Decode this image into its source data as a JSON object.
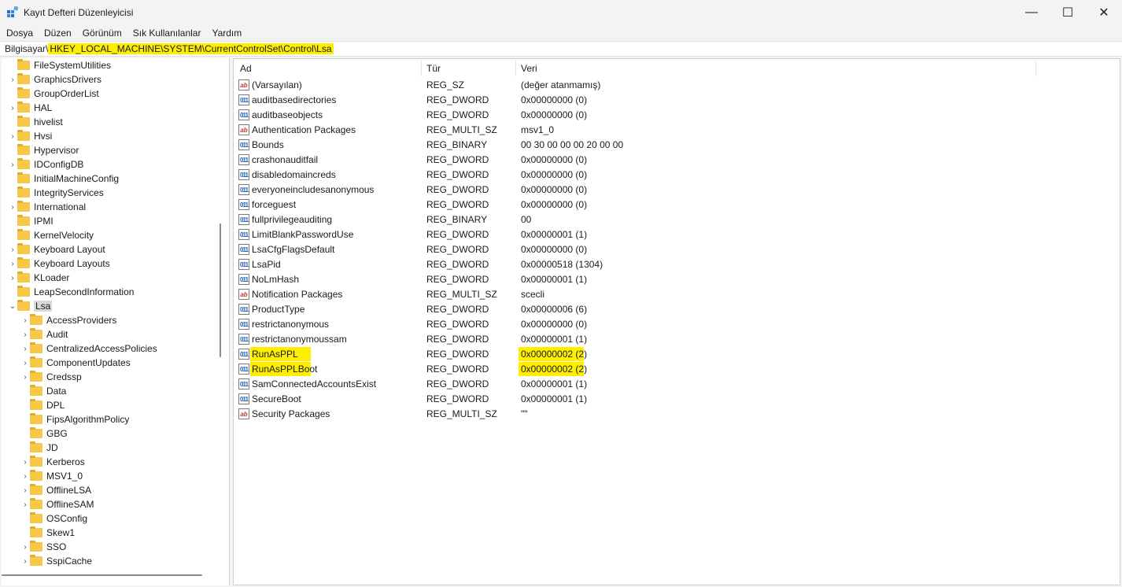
{
  "window": {
    "title": "Kayıt Defteri Düzenleyicisi",
    "min": "—",
    "max": "☐",
    "close": "✕"
  },
  "menu": [
    "Dosya",
    "Düzen",
    "Görünüm",
    "Sık Kullanılanlar",
    "Yardım"
  ],
  "address": {
    "root": "Bilgisayar",
    "sep": "\\",
    "path": "HKEY_LOCAL_MACHINE\\SYSTEM\\CurrentControlSet\\Control\\Lsa"
  },
  "tree": [
    {
      "label": "FileSystemUtilities",
      "expandable": false,
      "depth": 0
    },
    {
      "label": "GraphicsDrivers",
      "expandable": true,
      "depth": 0
    },
    {
      "label": "GroupOrderList",
      "expandable": false,
      "depth": 0
    },
    {
      "label": "HAL",
      "expandable": true,
      "depth": 0
    },
    {
      "label": "hivelist",
      "expandable": false,
      "depth": 0
    },
    {
      "label": "Hvsi",
      "expandable": true,
      "depth": 0
    },
    {
      "label": "Hypervisor",
      "expandable": false,
      "depth": 0
    },
    {
      "label": "IDConfigDB",
      "expandable": true,
      "depth": 0
    },
    {
      "label": "InitialMachineConfig",
      "expandable": false,
      "depth": 0
    },
    {
      "label": "IntegrityServices",
      "expandable": false,
      "depth": 0
    },
    {
      "label": "International",
      "expandable": true,
      "depth": 0
    },
    {
      "label": "IPMI",
      "expandable": false,
      "depth": 0
    },
    {
      "label": "KernelVelocity",
      "expandable": false,
      "depth": 0
    },
    {
      "label": "Keyboard Layout",
      "expandable": true,
      "depth": 0
    },
    {
      "label": "Keyboard Layouts",
      "expandable": true,
      "depth": 0
    },
    {
      "label": "KLoader",
      "expandable": true,
      "depth": 0
    },
    {
      "label": "LeapSecondInformation",
      "expandable": false,
      "depth": 0
    },
    {
      "label": "Lsa",
      "expandable": true,
      "expanded": true,
      "selected": true,
      "depth": 0
    },
    {
      "label": "AccessProviders",
      "expandable": true,
      "depth": 1
    },
    {
      "label": "Audit",
      "expandable": true,
      "depth": 1
    },
    {
      "label": "CentralizedAccessPolicies",
      "expandable": true,
      "depth": 1
    },
    {
      "label": "ComponentUpdates",
      "expandable": true,
      "depth": 1
    },
    {
      "label": "Credssp",
      "expandable": true,
      "depth": 1
    },
    {
      "label": "Data",
      "expandable": false,
      "depth": 1
    },
    {
      "label": "DPL",
      "expandable": false,
      "depth": 1
    },
    {
      "label": "FipsAlgorithmPolicy",
      "expandable": false,
      "depth": 1
    },
    {
      "label": "GBG",
      "expandable": false,
      "depth": 1
    },
    {
      "label": "JD",
      "expandable": false,
      "depth": 1
    },
    {
      "label": "Kerberos",
      "expandable": true,
      "depth": 1
    },
    {
      "label": "MSV1_0",
      "expandable": true,
      "depth": 1
    },
    {
      "label": "OfflineLSA",
      "expandable": true,
      "depth": 1
    },
    {
      "label": "OfflineSAM",
      "expandable": true,
      "depth": 1
    },
    {
      "label": "OSConfig",
      "expandable": false,
      "depth": 1
    },
    {
      "label": "Skew1",
      "expandable": false,
      "depth": 1
    },
    {
      "label": "SSO",
      "expandable": true,
      "depth": 1
    },
    {
      "label": "SspiCache",
      "expandable": true,
      "depth": 1
    }
  ],
  "columns": {
    "name": "Ad",
    "type": "Tür",
    "data": "Veri"
  },
  "values": [
    {
      "name": "(Varsayılan)",
      "type": "REG_SZ",
      "data": "(değer atanmamış)",
      "icon": "string"
    },
    {
      "name": "auditbasedirectories",
      "type": "REG_DWORD",
      "data": "0x00000000 (0)",
      "icon": "binary"
    },
    {
      "name": "auditbaseobjects",
      "type": "REG_DWORD",
      "data": "0x00000000 (0)",
      "icon": "binary"
    },
    {
      "name": "Authentication Packages",
      "type": "REG_MULTI_SZ",
      "data": "msv1_0",
      "icon": "string"
    },
    {
      "name": "Bounds",
      "type": "REG_BINARY",
      "data": "00 30 00 00 00 20 00 00",
      "icon": "binary"
    },
    {
      "name": "crashonauditfail",
      "type": "REG_DWORD",
      "data": "0x00000000 (0)",
      "icon": "binary"
    },
    {
      "name": "disabledomaincreds",
      "type": "REG_DWORD",
      "data": "0x00000000 (0)",
      "icon": "binary"
    },
    {
      "name": "everyoneincludesanonymous",
      "type": "REG_DWORD",
      "data": "0x00000000 (0)",
      "icon": "binary"
    },
    {
      "name": "forceguest",
      "type": "REG_DWORD",
      "data": "0x00000000 (0)",
      "icon": "binary"
    },
    {
      "name": "fullprivilegeauditing",
      "type": "REG_BINARY",
      "data": "00",
      "icon": "binary"
    },
    {
      "name": "LimitBlankPasswordUse",
      "type": "REG_DWORD",
      "data": "0x00000001 (1)",
      "icon": "binary"
    },
    {
      "name": "LsaCfgFlagsDefault",
      "type": "REG_DWORD",
      "data": "0x00000000 (0)",
      "icon": "binary"
    },
    {
      "name": "LsaPid",
      "type": "REG_DWORD",
      "data": "0x00000518 (1304)",
      "icon": "binary"
    },
    {
      "name": "NoLmHash",
      "type": "REG_DWORD",
      "data": "0x00000001 (1)",
      "icon": "binary"
    },
    {
      "name": "Notification Packages",
      "type": "REG_MULTI_SZ",
      "data": "scecli",
      "icon": "string"
    },
    {
      "name": "ProductType",
      "type": "REG_DWORD",
      "data": "0x00000006 (6)",
      "icon": "binary"
    },
    {
      "name": "restrictanonymous",
      "type": "REG_DWORD",
      "data": "0x00000000 (0)",
      "icon": "binary"
    },
    {
      "name": "restrictanonymoussam",
      "type": "REG_DWORD",
      "data": "0x00000001 (1)",
      "icon": "binary"
    },
    {
      "name": "RunAsPPL",
      "type": "REG_DWORD",
      "data": "0x00000002 (2)",
      "icon": "binary",
      "highlight": true
    },
    {
      "name": "RunAsPPLBoot",
      "type": "REG_DWORD",
      "data": "0x00000002 (2)",
      "icon": "binary",
      "highlight": true
    },
    {
      "name": "SamConnectedAccountsExist",
      "type": "REG_DWORD",
      "data": "0x00000001 (1)",
      "icon": "binary"
    },
    {
      "name": "SecureBoot",
      "type": "REG_DWORD",
      "data": "0x00000001 (1)",
      "icon": "binary"
    },
    {
      "name": "Security Packages",
      "type": "REG_MULTI_SZ",
      "data": "\"\"",
      "icon": "string"
    }
  ],
  "colors": {
    "highlight": "#ffee00",
    "folder": "#f6c74a"
  }
}
